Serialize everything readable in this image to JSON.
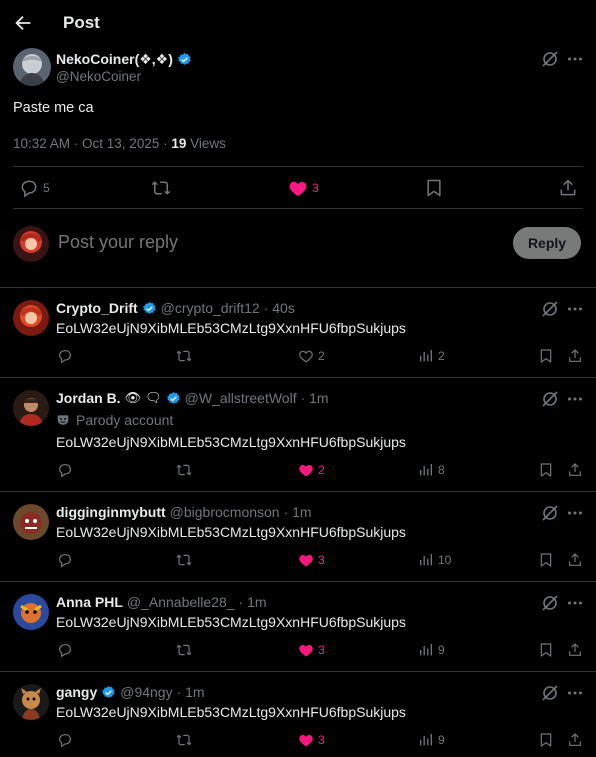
{
  "header": {
    "title": "Post"
  },
  "post": {
    "author_name": "NekoCoiner(❖,❖)",
    "author_handle": "@NekoCoiner",
    "text": "Paste me ca",
    "timestamp": "10:32 AM · Oct 13, 2025 · ",
    "views_count": "19",
    "views_label": " Views",
    "replies": "5",
    "reposts": "",
    "likes": "3"
  },
  "reply_box": {
    "placeholder": "Post your reply",
    "button_label": "Reply"
  },
  "replies": [
    {
      "name": "Crypto_Drift",
      "handle": "@crypto_drift12",
      "time": "· 40s",
      "text": "EoLW32eUjN9XibMLEb53CMzLtg9XxnHFU6fbpSukjups",
      "likes": "2",
      "views": "2",
      "liked": false
    },
    {
      "name": "Jordan B.",
      "emoji": "👁‍🗨",
      "handle": "@W_allstreetWolf",
      "time": "· 1m",
      "parody": "Parody account",
      "text": "EoLW32eUjN9XibMLEb53CMzLtg9XxnHFU6fbpSukjups",
      "likes": "2",
      "views": "8",
      "liked": true
    },
    {
      "name": "digginginmybutt",
      "handle": "@bigbrocmonson",
      "time": "· 1m",
      "text": "EoLW32eUjN9XibMLEb53CMzLtg9XxnHFU6fbpSukjups",
      "likes": "3",
      "views": "10",
      "liked": true
    },
    {
      "name": "Anna PHL",
      "handle": "@_Annabelle28_",
      "time": "· 1m",
      "text": "EoLW32eUjN9XibMLEb53CMzLtg9XxnHFU6fbpSukjups",
      "likes": "3",
      "views": "9",
      "liked": true
    },
    {
      "name": "gangy",
      "handle": "@94ngy",
      "time": "· 1m",
      "text": "EoLW32eUjN9XibMLEb53CMzLtg9XxnHFU6fbpSukjups",
      "likes": "3",
      "views": "9",
      "liked": true
    }
  ],
  "colors": {
    "like": "#f91880",
    "verified": "#1d9bf0",
    "muted": "#71767b",
    "divider": "#2f3336"
  }
}
